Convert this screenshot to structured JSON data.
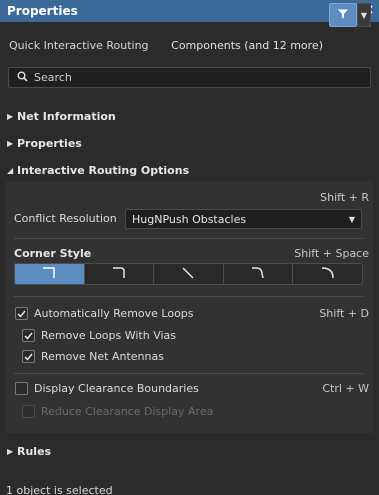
{
  "window": {
    "title": "Properties",
    "pin_icon": "pin-icon",
    "close_icon": "close-icon"
  },
  "filter": {
    "mode": "Quick Interactive Routing",
    "components": "Components (and 12 more)",
    "filter_icon": "filter-icon",
    "dropdown_icon": "chevron-down-icon"
  },
  "search": {
    "placeholder": "Search",
    "icon": "search-icon"
  },
  "sections": {
    "net_information": "Net Information",
    "properties": "Properties",
    "interactive_routing": "Interactive Routing Options",
    "rules": "Rules"
  },
  "routing": {
    "conflict_shortcut": "Shift + R",
    "conflict_label": "Conflict Resolution",
    "conflict_value": "HugNPush Obstacles",
    "corner_label": "Corner Style",
    "corner_shortcut": "Shift + Space",
    "corner_styles": [
      "corner-90-icon",
      "corner-rounded-icon",
      "corner-45-icon",
      "corner-45-arc-icon",
      "corner-arc-icon"
    ],
    "corner_selected": 0,
    "auto_remove_loops": {
      "label": "Automatically Remove Loops",
      "shortcut": "Shift + D",
      "checked": true
    },
    "remove_loops_vias": {
      "label": "Remove Loops With Vias",
      "checked": true
    },
    "remove_net_antennas": {
      "label": "Remove Net Antennas",
      "checked": true
    },
    "display_clearance": {
      "label": "Display Clearance Boundaries",
      "shortcut": "Ctrl + W",
      "checked": false
    },
    "reduce_clearance": {
      "label": "Reduce Clearance Display Area",
      "checked": false,
      "disabled": true
    }
  },
  "status": {
    "text": "1 object is selected"
  },
  "colors": {
    "titlebar": "#3c6a98",
    "accent": "#5d8cc0",
    "background": "#2b2b2b"
  }
}
